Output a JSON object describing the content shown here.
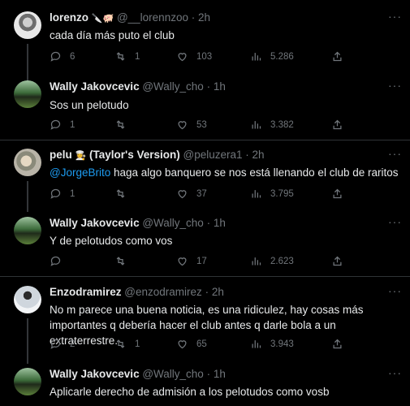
{
  "tweets": [
    {
      "name": "lorenzo",
      "name_emoji": "🔪🐖",
      "handle": "@__lorennzoo",
      "time": "2h",
      "text": "cada día más puto el club",
      "replies": "6",
      "retweets": "1",
      "likes": "103",
      "views": "5.286"
    },
    {
      "name": "Wally Jakovcevic",
      "handle": "@Wally_cho",
      "time": "1h",
      "text": "Sos un pelotudo",
      "replies": "1",
      "retweets": "",
      "likes": "53",
      "views": "3.382"
    },
    {
      "name": "pelu",
      "name_emoji": "👩‍🍳",
      "name_suffix": "(Taylor's Version)",
      "handle": "@peluzera1",
      "time": "2h",
      "mention": "@JorgeBrito",
      "text": " haga algo banquero se nos está llenando el club de raritos",
      "replies": "1",
      "retweets": "",
      "likes": "37",
      "views": "3.795"
    },
    {
      "name": "Wally Jakovcevic",
      "handle": "@Wally_cho",
      "time": "1h",
      "text": "Y de pelotudos como vos",
      "replies": "",
      "retweets": "",
      "likes": "17",
      "views": "2.623"
    },
    {
      "name": "Enzodramirez",
      "handle": "@enzodramirez",
      "time": "2h",
      "text_line1": "No m parece una buena noticia, es una ridiculez, hay cosas más",
      "text_line2": "importantes q debería hacer el club antes q darle bola a un extraterrestre.",
      "replies": "2",
      "retweets": "1",
      "likes": "65",
      "views": "3.943"
    },
    {
      "name": "Wally Jakovcevic",
      "handle": "@Wally_cho",
      "time": "1h",
      "text": "Aplicarle derecho de admisión a los pelotudos como vosb"
    }
  ],
  "separator": "·",
  "more_glyph": "···",
  "icons": [
    "reply-icon",
    "retweet-icon",
    "like-icon",
    "views-icon",
    "share-icon",
    "more-icon"
  ]
}
